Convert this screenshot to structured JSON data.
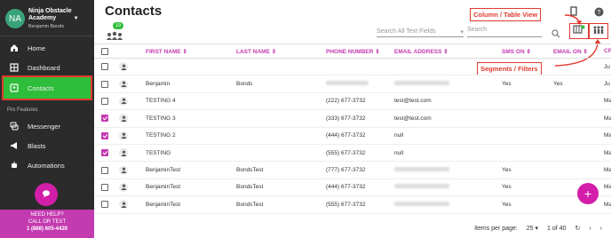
{
  "sidebar": {
    "brand_initials": "NA",
    "brand_name_line1": "Ninja Obstacle",
    "brand_name_line2": "Academy",
    "user": "Benjamin Bonds",
    "items": [
      {
        "label": "Home",
        "icon": "home-icon"
      },
      {
        "label": "Dashboard",
        "icon": "dashboard-icon"
      },
      {
        "label": "Contacts",
        "icon": "contacts-icon"
      }
    ],
    "section": "Pro Features",
    "pro_items": [
      {
        "label": "Messenger",
        "icon": "messenger-icon"
      },
      {
        "label": "Blasts",
        "icon": "megaphone-icon"
      },
      {
        "label": "Automations",
        "icon": "robot-icon"
      }
    ],
    "help_line1": "NEED HELP?",
    "help_line2": "CALL OR TEXT",
    "help_phone": "1 (888) 605-4429"
  },
  "header": {
    "title": "Contacts",
    "segment_count": "19",
    "search_all_placeholder": "Search All Text Fields",
    "search_placeholder": "Search"
  },
  "annotations": {
    "column_view": "Column / Table View",
    "segments": "Segments / Filters"
  },
  "table": {
    "headers": {
      "first": "FIRST NAME",
      "last": "LAST NAME",
      "phone": "PHONE NUMBER",
      "email": "EMAIL ADDRESS",
      "sms": "SMS ON",
      "emailon": "EMAIL ON",
      "extra": "CR"
    },
    "rows": [
      {
        "checked": false,
        "first": "",
        "last": "",
        "phone": "",
        "email": "",
        "sms": "",
        "emailon": "",
        "extra": "Ju"
      },
      {
        "checked": false,
        "first": "Benjamin",
        "last": "Bonds",
        "phone": "",
        "email": "",
        "sms": "Yes",
        "emailon": "Yes",
        "extra": "Ju"
      },
      {
        "checked": false,
        "first": "TESTING 4",
        "last": "",
        "phone": "(222) 677-3732",
        "email": "test@test.com",
        "sms": "",
        "emailon": "",
        "extra": "Ma"
      },
      {
        "checked": true,
        "first": "TESTING 3",
        "last": "",
        "phone": "(333) 677-3732",
        "email": "test@test.com",
        "sms": "",
        "emailon": "",
        "extra": "Ma"
      },
      {
        "checked": true,
        "first": "TESTING 2",
        "last": "",
        "phone": "(444) 677-3732",
        "email": "null",
        "sms": "",
        "emailon": "",
        "extra": "Ma"
      },
      {
        "checked": true,
        "first": "TESTING",
        "last": "",
        "phone": "(555) 677-3732",
        "email": "null",
        "sms": "",
        "emailon": "",
        "extra": "Ma"
      },
      {
        "checked": false,
        "first": "BenjaminTest",
        "last": "BondsTest",
        "phone": "(777) 677-3732",
        "email": "",
        "sms": "Yes",
        "emailon": "",
        "extra": "Ma"
      },
      {
        "checked": false,
        "first": "BenjaminTest",
        "last": "BondsTest",
        "phone": "(444) 677-3732",
        "email": "",
        "sms": "Yes",
        "emailon": "",
        "extra": "Ma"
      },
      {
        "checked": false,
        "first": "BenjaminTest",
        "last": "BondsTest",
        "phone": "(555) 677-3732",
        "email": "",
        "sms": "Yes",
        "emailon": "",
        "extra": "Ma"
      }
    ]
  },
  "footer": {
    "items_label": "Items per page:",
    "per_page": "25",
    "range": "1 of 40"
  },
  "colors": {
    "accent": "#c43ab0",
    "green": "#2ebd3a",
    "highlight": "#e03a2f"
  }
}
